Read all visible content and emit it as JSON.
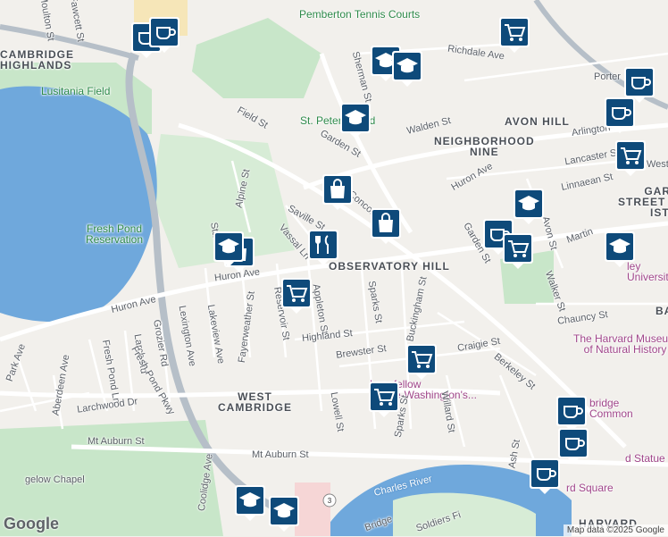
{
  "map": {
    "neighborhoods": [
      {
        "id": "cambridge-highlands",
        "text": "CAMBRIDGE\nHIGHLANDS"
      },
      {
        "id": "avon-hill",
        "text": "AVON HILL"
      },
      {
        "id": "neighborhood-nine",
        "text": "NEIGHBORHOOD\nNINE"
      },
      {
        "id": "observatory-hill",
        "text": "OBSERVATORY HILL"
      },
      {
        "id": "west-cambridge",
        "text": "WEST\nCAMBRIDGE"
      },
      {
        "id": "garden-street-historic",
        "text": "GARF\nSTREET H\nISTR"
      },
      {
        "id": "harvard",
        "text": "HARVARD"
      },
      {
        "id": "ba",
        "text": "BA"
      }
    ],
    "parks": [
      {
        "id": "lusitania-field",
        "text": "Lusitania Field"
      },
      {
        "id": "fresh-pond-reservation",
        "text": "Fresh Pond\nReservation"
      },
      {
        "id": "pemberton-tennis-courts",
        "text": "Pemberton Tennis Courts"
      },
      {
        "id": "st-peter-field",
        "text": "St. Peter's Field"
      }
    ],
    "pois": [
      {
        "id": "harvard-museum",
        "text": "The Harvard Museum\nof Natural History"
      },
      {
        "id": "longfellow-house",
        "text": "Longfellow\nHouse-Washington's..."
      },
      {
        "id": "bridge-common",
        "text": "bridge\nCommon"
      },
      {
        "id": "lesley-university",
        "text": "ley\nUniversity"
      },
      {
        "id": "statue",
        "text": "d Statue"
      },
      {
        "id": "harvard-square",
        "text": "rd Square"
      },
      {
        "id": "gelow-chapel",
        "text": "gelow Chapel"
      }
    ],
    "water": [
      {
        "id": "charles-river",
        "text": "Charles River"
      }
    ],
    "streets": [
      {
        "id": "moulton-st",
        "text": "Moulton St"
      },
      {
        "id": "fawcett-st",
        "text": "Fawcett St"
      },
      {
        "id": "richdale-ave",
        "text": "Richdale Ave"
      },
      {
        "id": "sherman-st",
        "text": "Sherman St"
      },
      {
        "id": "porter",
        "text": "Porter"
      },
      {
        "id": "field-st",
        "text": "Field St"
      },
      {
        "id": "walden-st",
        "text": "Walden St"
      },
      {
        "id": "arlington",
        "text": "Arlington"
      },
      {
        "id": "garden-st-1",
        "text": "Garden St"
      },
      {
        "id": "lancaster-st",
        "text": "Lancaster St"
      },
      {
        "id": "west-st",
        "text": "West St"
      },
      {
        "id": "huron-ave-1",
        "text": "Huron Ave"
      },
      {
        "id": "linnaean-st",
        "text": "Linnaean St"
      },
      {
        "id": "alpine-st",
        "text": "Alpine St"
      },
      {
        "id": "saville-st",
        "text": "Saville St"
      },
      {
        "id": "concord-ave",
        "text": "Concord Ave"
      },
      {
        "id": "vassal-ln",
        "text": "Vassal Ln"
      },
      {
        "id": "stannard",
        "text": "Stannar"
      },
      {
        "id": "garden-st-2",
        "text": "Garden St"
      },
      {
        "id": "avon-st",
        "text": "Avon St"
      },
      {
        "id": "martin",
        "text": "Martin"
      },
      {
        "id": "huron-ave-2",
        "text": "Huron Ave"
      },
      {
        "id": "huron-ave-3",
        "text": "Huron Ave"
      },
      {
        "id": "walker-st",
        "text": "Walker St"
      },
      {
        "id": "reservoir-st",
        "text": "Reservoir St"
      },
      {
        "id": "appleton-st",
        "text": "Appleton St"
      },
      {
        "id": "sparks-st-1",
        "text": "Sparks St"
      },
      {
        "id": "buckingham-st",
        "text": "Buckingham St"
      },
      {
        "id": "chauncy-st",
        "text": "Chauncy St"
      },
      {
        "id": "grozier-rd",
        "text": "Grozier Rd"
      },
      {
        "id": "lexington-ave",
        "text": "Lexington Ave"
      },
      {
        "id": "lakeview-ave",
        "text": "Lakeview Ave"
      },
      {
        "id": "fayerweather-st",
        "text": "Fayerweather St"
      },
      {
        "id": "park-ave",
        "text": "Park Ave"
      },
      {
        "id": "larch-rd",
        "text": "Larch Rd"
      },
      {
        "id": "highland-st",
        "text": "Highland St"
      },
      {
        "id": "fresh-pond-ln",
        "text": "Fresh Pond Ln"
      },
      {
        "id": "aberdeen-ave",
        "text": "Aberdeen Ave"
      },
      {
        "id": "fresh-pond-pkwy",
        "text": "Fresh Pond Pkwy"
      },
      {
        "id": "brewster-st",
        "text": "Brewster St"
      },
      {
        "id": "craigie-st",
        "text": "Craigie St"
      },
      {
        "id": "berkeley-st",
        "text": "Berkeley St"
      },
      {
        "id": "larchwood-dr",
        "text": "Larchwood Dr"
      },
      {
        "id": "lowell-st",
        "text": "Lowell St"
      },
      {
        "id": "sparks-st-2",
        "text": "Sparks St"
      },
      {
        "id": "willard-st",
        "text": "Willard St"
      },
      {
        "id": "mt-auburn-st-1",
        "text": "Mt Auburn St"
      },
      {
        "id": "mt-auburn-st-2",
        "text": "Mt Auburn St"
      },
      {
        "id": "ash-st",
        "text": "Ash St"
      },
      {
        "id": "coolidge-ave",
        "text": "Coolidge Ave"
      },
      {
        "id": "bridge",
        "text": "Bridge"
      },
      {
        "id": "soldiers-field",
        "text": "Soldiers Fi"
      }
    ],
    "route_shield": "3",
    "google_logo": "Google",
    "attribution": "Map data ©2025 Google",
    "colors": {
      "land": "#f2f0ec",
      "park": "#c8e6c9",
      "water": "#6fa8dc",
      "highway": "#b6bfc8",
      "road": "#ffffff",
      "pin": "#0e4a7a"
    },
    "markers": [
      {
        "id": "cafe-1",
        "icon": "cafe-icon"
      },
      {
        "id": "cafe-2",
        "icon": "cafe-icon"
      },
      {
        "id": "school-1",
        "icon": "school-icon"
      },
      {
        "id": "school-2",
        "icon": "school-icon"
      },
      {
        "id": "grocery-1",
        "icon": "grocery-icon"
      },
      {
        "id": "school-3",
        "icon": "school-icon"
      },
      {
        "id": "cafe-3",
        "icon": "cafe-icon"
      },
      {
        "id": "cafe-4",
        "icon": "cafe-icon"
      },
      {
        "id": "grocery-2",
        "icon": "grocery-icon"
      },
      {
        "id": "shopping-1",
        "icon": "shopping-bag-icon"
      },
      {
        "id": "shopping-2",
        "icon": "shopping-bag-icon"
      },
      {
        "id": "school-4",
        "icon": "school-icon"
      },
      {
        "id": "school-5",
        "icon": "school-icon"
      },
      {
        "id": "cafe-5",
        "icon": "cafe-icon"
      },
      {
        "id": "grocery-3",
        "icon": "grocery-icon"
      },
      {
        "id": "restaurant-1",
        "icon": "restaurant-icon"
      },
      {
        "id": "shopping-3",
        "icon": "shopping-bag-icon"
      },
      {
        "id": "grocery-4",
        "icon": "grocery-icon"
      },
      {
        "id": "grocery-5",
        "icon": "grocery-icon"
      },
      {
        "id": "grocery-6",
        "icon": "grocery-icon"
      },
      {
        "id": "school-6",
        "icon": "school-icon"
      },
      {
        "id": "cafe-6",
        "icon": "cafe-icon"
      },
      {
        "id": "cafe-7",
        "icon": "cafe-icon"
      },
      {
        "id": "cafe-8",
        "icon": "cafe-icon"
      },
      {
        "id": "school-7",
        "icon": "school-icon"
      },
      {
        "id": "school-8",
        "icon": "school-icon"
      }
    ]
  }
}
